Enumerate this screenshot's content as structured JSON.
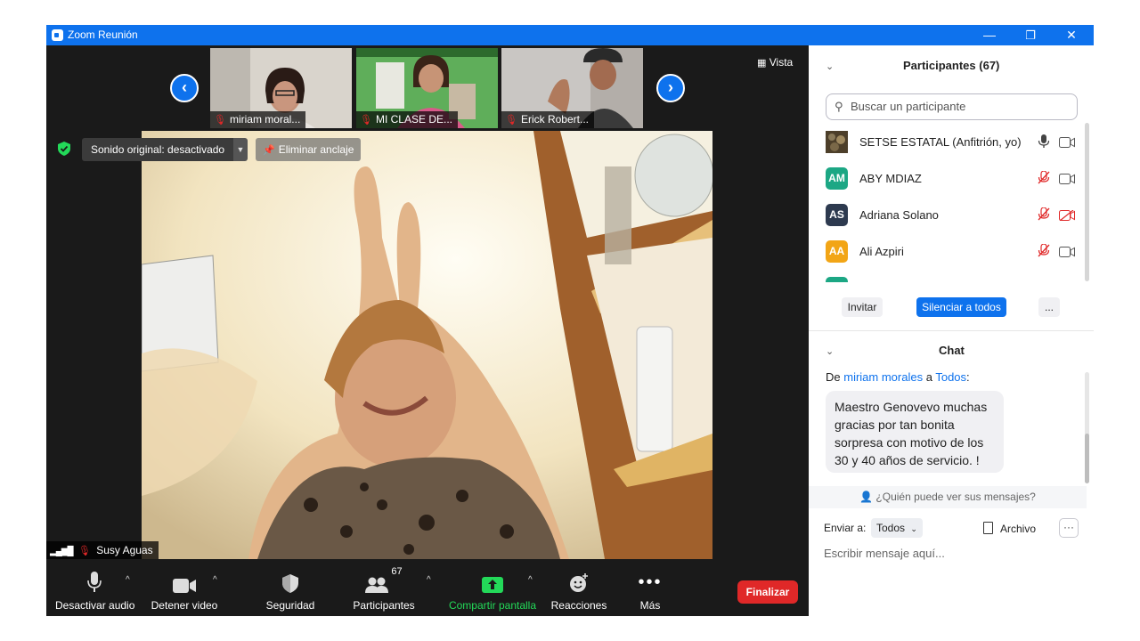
{
  "window": {
    "title": "Zoom Reunión",
    "minimize": "—",
    "restore": "❐",
    "close": "✕"
  },
  "meeting": {
    "view_label": "Vista",
    "thumbnails": [
      {
        "name": "miriam moral..."
      },
      {
        "name": "MI CLASE DE..."
      },
      {
        "name": "Erick Robert..."
      }
    ],
    "original_sound": "Sonido original: desactivado",
    "unpin": "Eliminar anclaje",
    "active_speaker": "Susy Aguas"
  },
  "toolbar": {
    "audio": "Desactivar audio",
    "video": "Detener video",
    "security": "Seguridad",
    "participants": "Participantes",
    "participant_count": "67",
    "share": "Compartir pantalla",
    "reactions": "Reacciones",
    "more": "Más",
    "end": "Finalizar"
  },
  "participants_panel": {
    "title": "Participantes (67)",
    "search_placeholder": "Buscar un participante",
    "rows": [
      {
        "initials": "",
        "name": "SETSE ESTATAL (Anfitrión, yo)",
        "color": "#6b5a3a",
        "mic": "on",
        "video": "on"
      },
      {
        "initials": "AM",
        "name": "ABY MDIAZ",
        "color": "#1ca784",
        "mic": "muted",
        "video": "on"
      },
      {
        "initials": "AS",
        "name": "Adriana Solano",
        "color": "#2d3a4f",
        "mic": "muted",
        "video": "off"
      },
      {
        "initials": "AA",
        "name": "Ali Azpiri",
        "color": "#f2a516",
        "mic": "muted",
        "video": "on"
      }
    ],
    "invite": "Invitar",
    "mute_all": "Silenciar a todos",
    "more": "..."
  },
  "chat": {
    "title": "Chat",
    "from_prefix": "De",
    "from_name": "miriam morales",
    "to_word": "a",
    "to_name": "Todos",
    "message": "Maestro Genovevo muchas gracias por tan bonita sorpresa con motivo de los 30  y 40 años de servicio. !",
    "who_can_see": "¿Quién puede ver sus mensajes?",
    "send_to_label": "Enviar a:",
    "send_to_value": "Todos",
    "file": "Archivo",
    "more": "···",
    "input_placeholder": "Escribir mensaje aquí..."
  }
}
